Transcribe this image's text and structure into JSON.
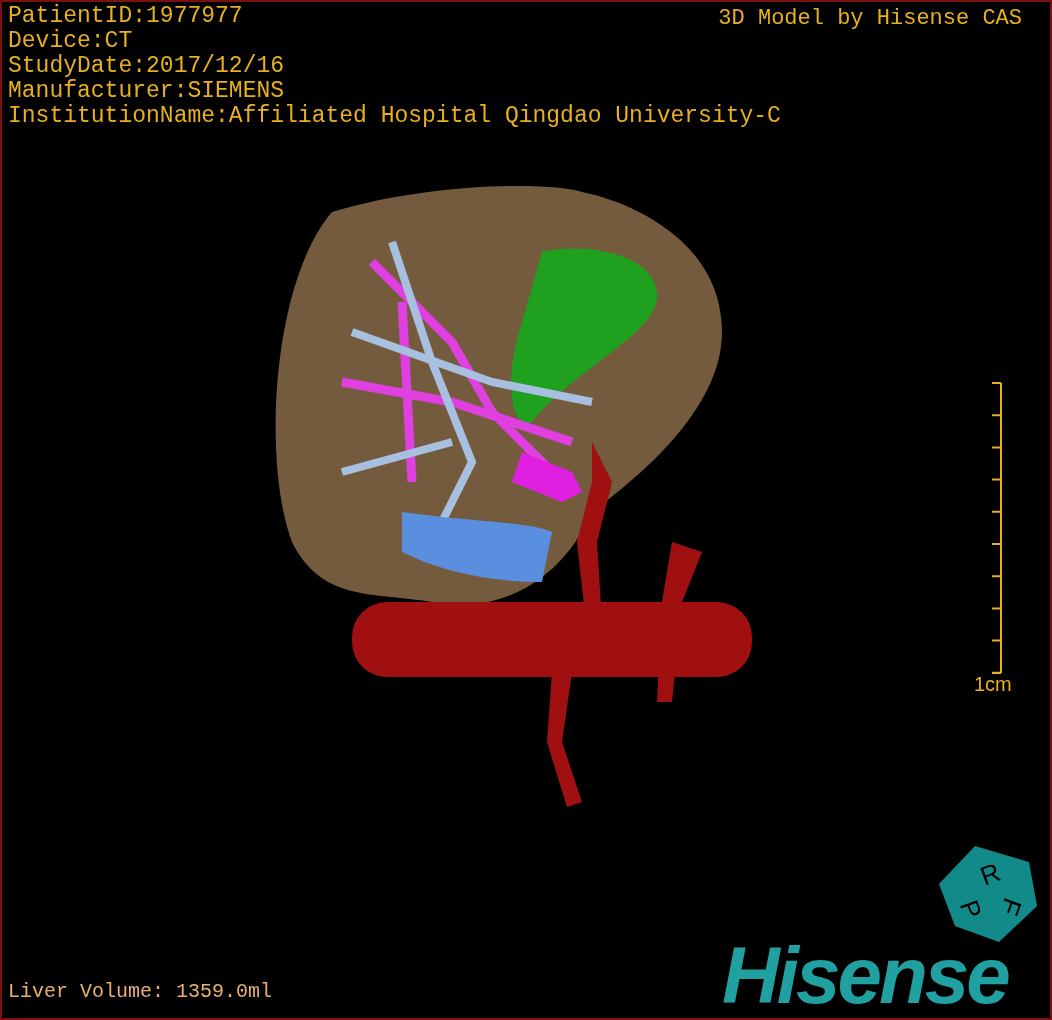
{
  "patient_info": [
    "PatientID:1977977",
    "Device:CT",
    "StudyDate:2017/12/16",
    "Manufacturer:SIEMENS",
    "InstitutionName:Affiliated Hospital Qingdao University-C"
  ],
  "title": "3D Model by Hisense CAS",
  "scale_bar": {
    "label": "1cm"
  },
  "orientation_cube": {
    "faces": [
      "P",
      "R",
      "F"
    ]
  },
  "logo": "Hisense",
  "liver_volume": "Liver Volume: 1359.0ml"
}
